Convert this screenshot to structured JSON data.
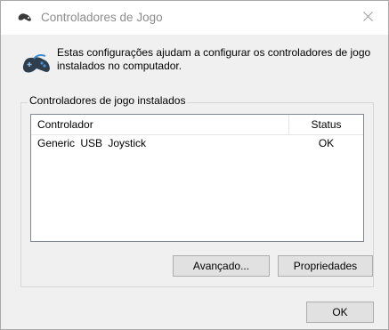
{
  "window": {
    "title": "Controladores de Jogo",
    "title_icon": "gamepad-icon",
    "close_icon": "close-icon"
  },
  "header": {
    "icon": "gamepad-icon",
    "text": "Estas configurações ajudam a configurar os controladores de jogo instalados no computador."
  },
  "group": {
    "label": "Controladores de jogo instalados",
    "list": {
      "columns": [
        "Controlador",
        "Status"
      ],
      "rows": [
        {
          "controller": "Generic  USB  Joystick",
          "status": "OK"
        }
      ]
    }
  },
  "buttons": {
    "advanced": "Avançado...",
    "properties": "Propriedades",
    "ok": "OK"
  }
}
